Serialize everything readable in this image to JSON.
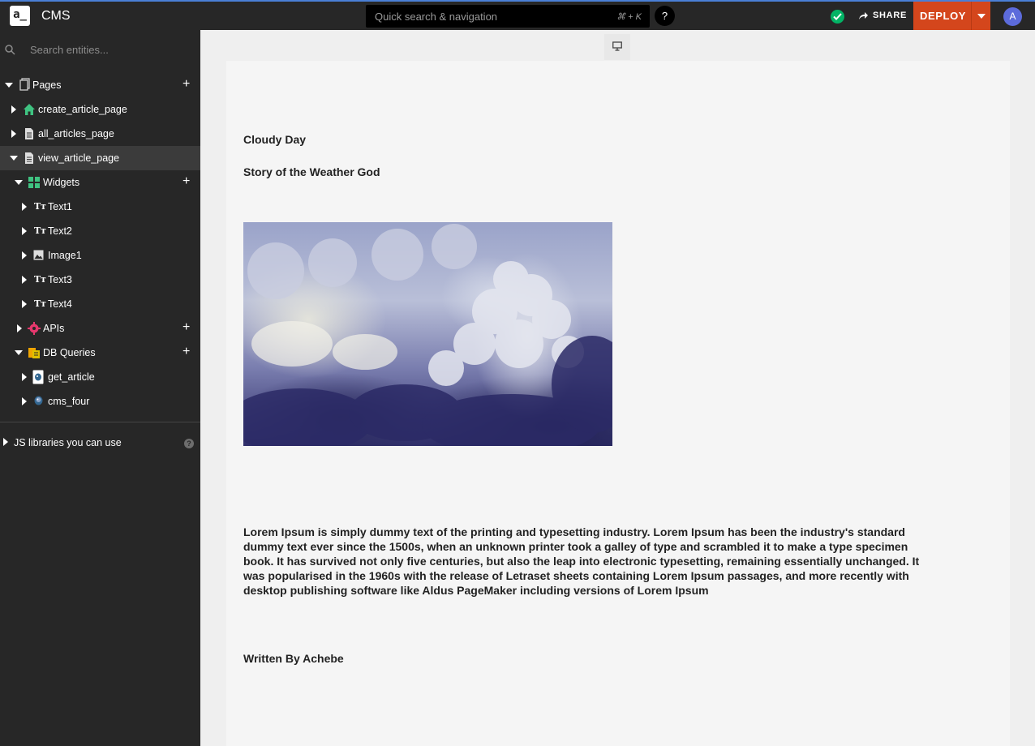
{
  "header": {
    "logo_text": "a_",
    "app_title": "CMS",
    "quick_search_placeholder": "Quick search & navigation",
    "quick_search_shortcut": "⌘ + K",
    "help_label": "?",
    "share_label": "SHARE",
    "deploy_label": "DEPLOY",
    "avatar_initial": "A",
    "status_color": "#03b365",
    "deploy_color": "#d4461c"
  },
  "sidebar": {
    "search_placeholder": "Search entities...",
    "pages_label": "Pages",
    "pages": [
      {
        "label": "create_article_page",
        "icon": "home-icon"
      },
      {
        "label": "all_articles_page",
        "icon": "page-icon"
      },
      {
        "label": "view_article_page",
        "icon": "page-icon",
        "selected": true
      }
    ],
    "widgets_label": "Widgets",
    "widgets": [
      {
        "label": "Text1",
        "icon": "text-widget-icon"
      },
      {
        "label": "Text2",
        "icon": "text-widget-icon"
      },
      {
        "label": "Image1",
        "icon": "image-widget-icon"
      },
      {
        "label": "Text3",
        "icon": "text-widget-icon"
      },
      {
        "label": "Text4",
        "icon": "text-widget-icon"
      }
    ],
    "apis_label": "APIs",
    "db_queries_label": "DB Queries",
    "queries": [
      {
        "label": "get_article",
        "icon": "postgres-query-icon"
      },
      {
        "label": "cms_four",
        "icon": "postgres-datasource-icon"
      }
    ],
    "js_libraries_label": "JS libraries you can use",
    "text_widget_glyph": "Tт"
  },
  "canvas": {
    "title": "Cloudy Day",
    "subtitle": "Story of the Weather God",
    "body": "Lorem Ipsum is simply dummy text of the printing and typesetting industry. Lorem Ipsum has been the industry's standard dummy text ever since the 1500s, when an unknown printer took a galley of type and scrambled it to make a type specimen book. It has survived not only five centuries, but also the leap into electronic typesetting, remaining essentially unchanged. It was popularised in the 1960s with the release of Letraset sheets containing Lorem Ipsum passages, and more recently with desktop publishing software like Aldus PageMaker including versions of Lorem Ipsum",
    "author": "Written By Achebe"
  }
}
